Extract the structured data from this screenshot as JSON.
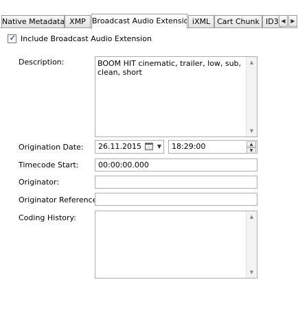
{
  "tabs": [
    {
      "label": "Native Metadata"
    },
    {
      "label": "XMP"
    },
    {
      "label": "Broadcast Audio Extension"
    },
    {
      "label": "iXML"
    },
    {
      "label": "Cart Chunk"
    },
    {
      "label": "ID3"
    }
  ],
  "active_tab": "Broadcast Audio Extension",
  "tab_scroll": {
    "left_icon": "arrow-left-icon",
    "right_icon": "arrow-right-icon"
  },
  "include_checkbox": {
    "label": "Include Broadcast Audio Extension",
    "checked": true
  },
  "form": {
    "description": {
      "label": "Description:",
      "value": "BOOM HIT cinematic, trailer, low, sub, clean, short"
    },
    "origination_date": {
      "label": "Origination Date:",
      "date": "26.11.2015",
      "time": "18:29:00"
    },
    "timecode_start": {
      "label": "Timecode Start:",
      "value": "00:00:00.000"
    },
    "originator": {
      "label": "Originator:",
      "value": ""
    },
    "originator_reference": {
      "label": "Originator Reference:",
      "value": ""
    },
    "coding_history": {
      "label": "Coding History:",
      "value": ""
    }
  }
}
